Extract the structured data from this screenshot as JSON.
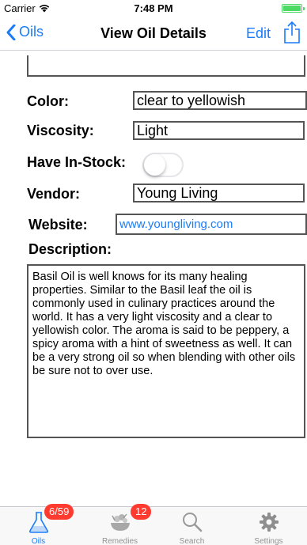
{
  "status_bar": {
    "carrier": "Carrier",
    "time": "7:48 PM"
  },
  "nav": {
    "back_label": "Oils",
    "title": "View Oil Details",
    "edit_label": "Edit"
  },
  "form": {
    "color_label": "Color:",
    "color_value": "clear to yellowish",
    "viscosity_label": "Viscosity:",
    "viscosity_value": "Light",
    "in_stock_label": "Have In-Stock:",
    "in_stock_on": false,
    "vendor_label": "Vendor:",
    "vendor_value": "Young Living",
    "website_label": "Website:",
    "website_value": "www.youngliving.com",
    "description_label": "Description:",
    "description_value": "Basil Oil is well knows for its many healing properties.  Similar to the Basil leaf the oil is commonly used in culinary practices around the world.  It has a very light viscosity and a clear to yellowish color.  The aroma is said to be peppery, a spicy aroma with a hint of sweetness as well.  It can be a very strong oil so when blending with other oils be sure not to over use."
  },
  "tabs": [
    {
      "label": "Oils",
      "icon": "flask-icon",
      "badge": "6/59",
      "active": true
    },
    {
      "label": "Remedies",
      "icon": "herb-bowl-icon",
      "badge": "12",
      "active": false
    },
    {
      "label": "Search",
      "icon": "search-icon",
      "badge": "",
      "active": false
    },
    {
      "label": "Settings",
      "icon": "gear-icon",
      "badge": "",
      "active": false
    }
  ],
  "colors": {
    "accent": "#1a7cfa",
    "badge": "#ff3b30",
    "battery": "#4cd964"
  }
}
